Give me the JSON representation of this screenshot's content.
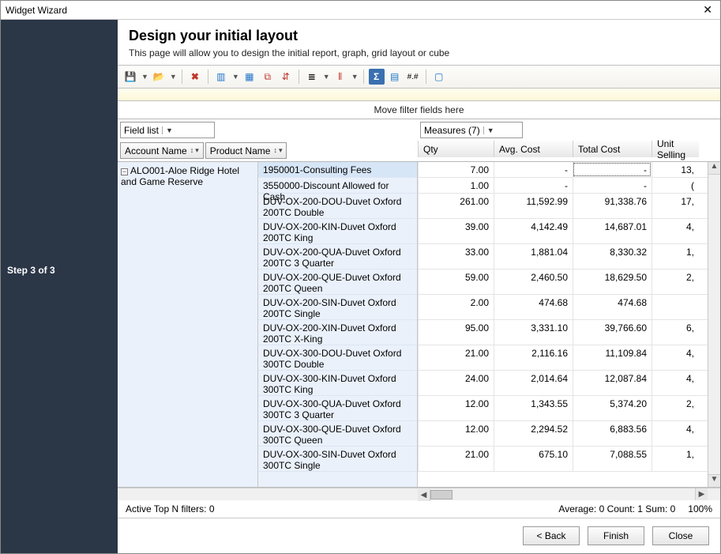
{
  "window": {
    "title": "Widget Wizard"
  },
  "sidebar": {
    "step": "Step 3 of 3"
  },
  "header": {
    "title": "Design your initial layout",
    "desc": "This page will allow you to design the initial report, graph, grid layout or cube"
  },
  "filter_drop": "Move filter fields here",
  "field_list_label": "Field list",
  "measures_label": "Measures (7)",
  "row_fields": [
    {
      "label": "Account Name"
    },
    {
      "label": "Product Name"
    }
  ],
  "measure_headers": [
    "Qty",
    "Avg. Cost",
    "Total Cost",
    "Unit Selling"
  ],
  "account": "ALO001-Aloe Ridge Hotel and Game Reserve",
  "rows": [
    {
      "product": "1950001-Consulting Fees",
      "lines": 1,
      "qty": "7.00",
      "avg": "-",
      "tot": "-",
      "sell": "13,",
      "selected": true
    },
    {
      "product": "3550000-Discount Allowed for Cash",
      "lines": 1,
      "qty": "1.00",
      "avg": "-",
      "tot": "-",
      "sell": "("
    },
    {
      "product": "DUV-OX-200-DOU-Duvet Oxford 200TC Double",
      "lines": 2,
      "qty": "261.00",
      "avg": "11,592.99",
      "tot": "91,338.76",
      "sell": "17,"
    },
    {
      "product": "DUV-OX-200-KIN-Duvet Oxford 200TC King",
      "lines": 2,
      "qty": "39.00",
      "avg": "4,142.49",
      "tot": "14,687.01",
      "sell": "4,"
    },
    {
      "product": "DUV-OX-200-QUA-Duvet Oxford 200TC 3 Quarter",
      "lines": 2,
      "qty": "33.00",
      "avg": "1,881.04",
      "tot": "8,330.32",
      "sell": "1,"
    },
    {
      "product": "DUV-OX-200-QUE-Duvet Oxford 200TC Queen",
      "lines": 2,
      "qty": "59.00",
      "avg": "2,460.50",
      "tot": "18,629.50",
      "sell": "2,"
    },
    {
      "product": "DUV-OX-200-SIN-Duvet Oxford 200TC Single",
      "lines": 2,
      "qty": "2.00",
      "avg": "474.68",
      "tot": "474.68",
      "sell": ""
    },
    {
      "product": "DUV-OX-200-XIN-Duvet Oxford 200TC X-King",
      "lines": 2,
      "qty": "95.00",
      "avg": "3,331.10",
      "tot": "39,766.60",
      "sell": "6,"
    },
    {
      "product": "DUV-OX-300-DOU-Duvet Oxford 300TC Double",
      "lines": 2,
      "qty": "21.00",
      "avg": "2,116.16",
      "tot": "11,109.84",
      "sell": "4,"
    },
    {
      "product": "DUV-OX-300-KIN-Duvet Oxford 300TC King",
      "lines": 2,
      "qty": "24.00",
      "avg": "2,014.64",
      "tot": "12,087.84",
      "sell": "4,"
    },
    {
      "product": "DUV-OX-300-QUA-Duvet Oxford 300TC 3 Quarter",
      "lines": 2,
      "qty": "12.00",
      "avg": "1,343.55",
      "tot": "5,374.20",
      "sell": "2,"
    },
    {
      "product": "DUV-OX-300-QUE-Duvet Oxford 300TC Queen",
      "lines": 2,
      "qty": "12.00",
      "avg": "2,294.52",
      "tot": "6,883.56",
      "sell": "4,"
    },
    {
      "product": "DUV-OX-300-SIN-Duvet Oxford 300TC Single",
      "lines": 2,
      "qty": "21.00",
      "avg": "675.10",
      "tot": "7,088.55",
      "sell": "1,"
    }
  ],
  "status": {
    "filters": "Active Top N filters: 0",
    "agg": "Average: 0  Count: 1  Sum: 0",
    "zoom": "100%"
  },
  "footer": {
    "back": "< Back",
    "finish": "Finish",
    "close": "Close"
  }
}
